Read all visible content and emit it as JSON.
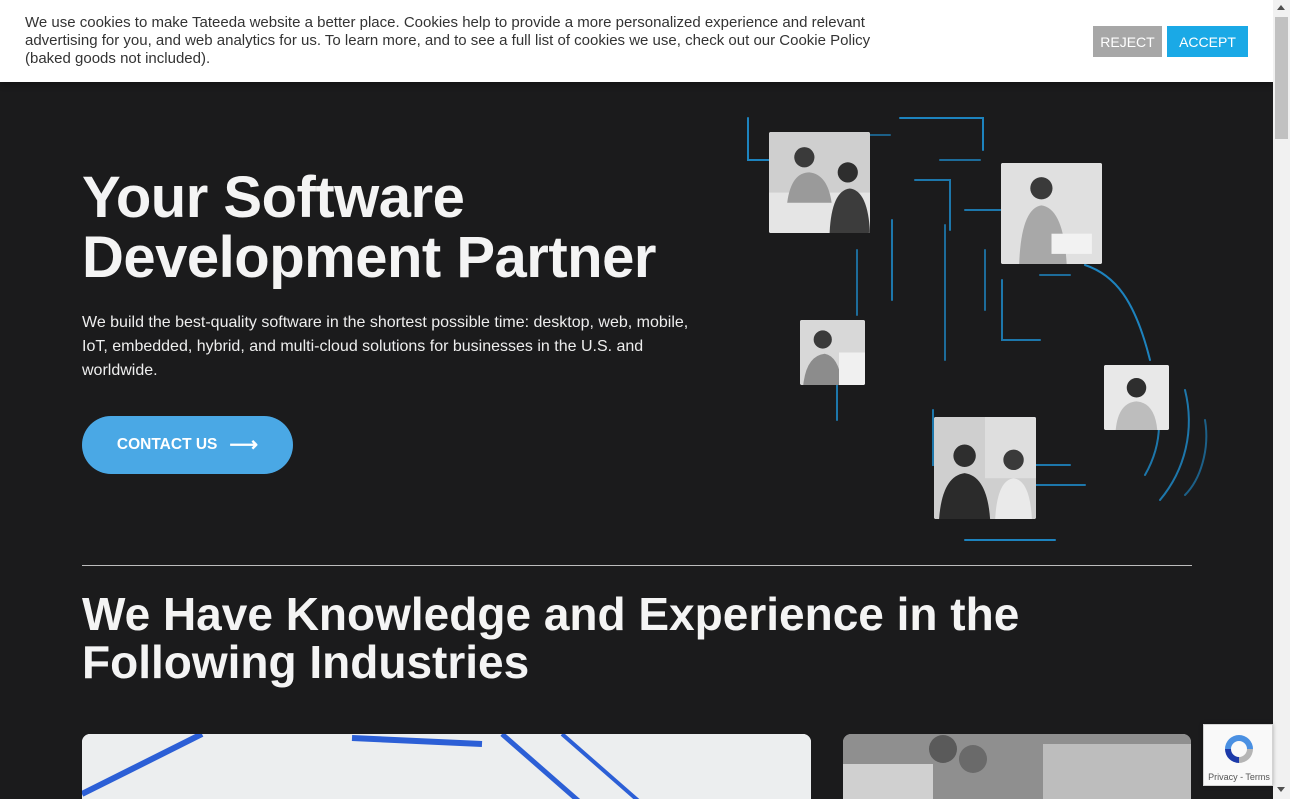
{
  "cookie": {
    "text": "We use cookies to make Tateeda website a better place. Cookies help to provide a more personalized experience and relevant advertising for you, and web analytics for us. To learn more, and to see a full list of cookies we use, check out our Cookie Policy (baked goods not included).",
    "reject_label": "REJECT",
    "accept_label": "ACCEPT"
  },
  "hero": {
    "title_line1": "Your Software",
    "title_line2": "Development Partner",
    "subtitle": "We build the best-quality software in the shortest possible time: desktop, web, mobile, IoT, embedded, hybrid, and multi-cloud solutions for businesses in the U.S. and worldwide.",
    "cta_label": "CONTACT US",
    "cta_arrow": "⟶"
  },
  "industries": {
    "title": "We Have Knowledge and Experience in the Following Industries"
  },
  "recaptcha": {
    "terms": "Privacy - Terms"
  },
  "colors": {
    "background": "#1b1b1c",
    "accent": "#4aa8e5",
    "accept": "#1aa9e6",
    "reject": "#a7a7a7",
    "line_glow": "#1e8fd0"
  },
  "icons": {
    "cta_arrow": "arrow-right-icon",
    "recaptcha": "recaptcha-icon"
  }
}
